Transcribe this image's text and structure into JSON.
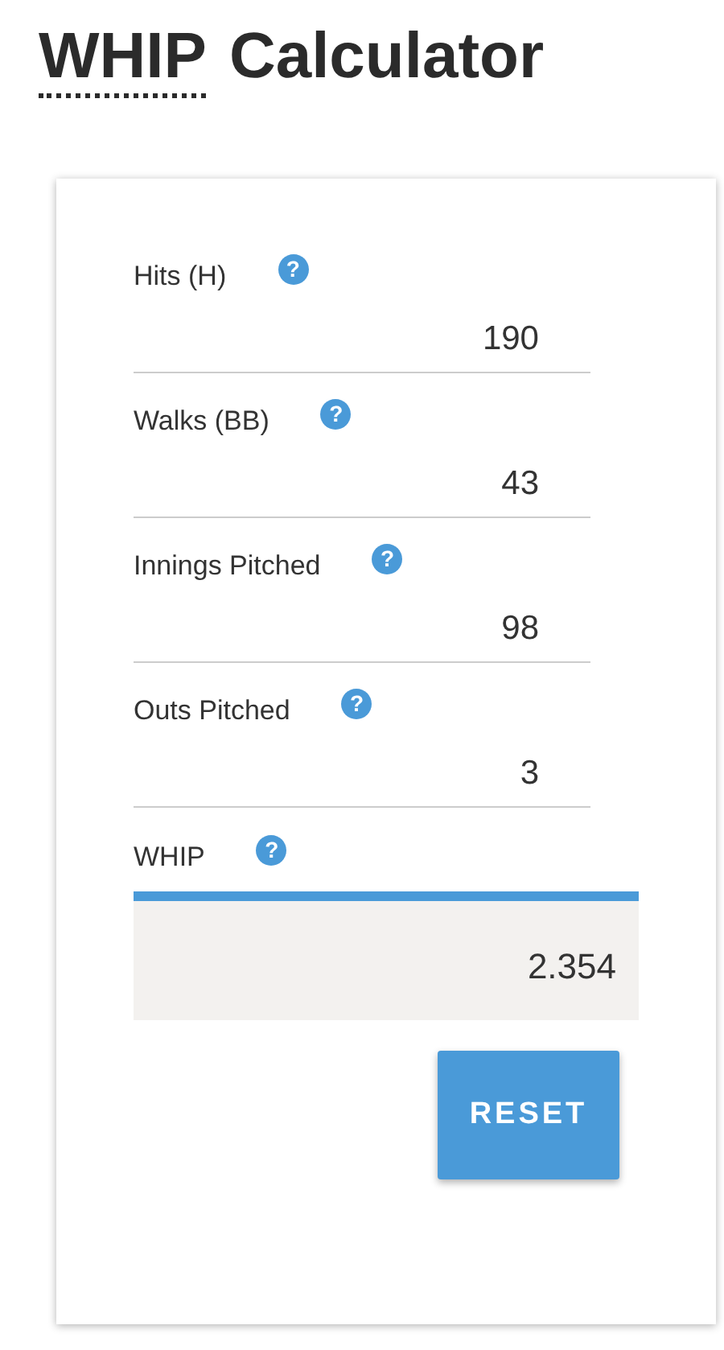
{
  "title": {
    "abbr": "WHIP",
    "rest": "Calculator"
  },
  "fields": [
    {
      "label": "Hits (H)",
      "help": "?",
      "value": "190"
    },
    {
      "label": "Walks (BB)",
      "help": "?",
      "value": "43"
    },
    {
      "label": "Innings Pitched",
      "help": "?",
      "value": "98"
    },
    {
      "label": "Outs Pitched",
      "help": "?",
      "value": "3"
    }
  ],
  "result": {
    "label": "WHIP",
    "help": "?",
    "value": "2.354"
  },
  "buttons": [
    "RESET"
  ]
}
